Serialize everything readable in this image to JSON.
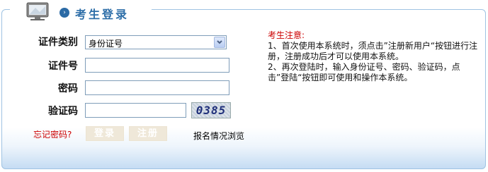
{
  "header": {
    "title": "考生登录"
  },
  "form": {
    "id_type_label": "证件类别",
    "id_type_value": "身份证号",
    "id_number_label": "证件号",
    "id_number_value": "",
    "password_label": "密码",
    "password_value": "",
    "captcha_label": "验证码",
    "captcha_value": "",
    "captcha_image_text": "0385",
    "forgot_password": "忘记密码?",
    "login_button": "登录",
    "register_button": "注册",
    "status_link": "报名情况浏览"
  },
  "notice": {
    "title": "考生注意:",
    "item1": "1、首次使用本系统时，须点击”注册新用户“按钮进行注册，注册成功后才可以使用本系统。",
    "item2": "2、再次登陆时，输入身份证号、密码、验证码，点击”登陆“按钮即可使用和操作本系统。"
  },
  "colors": {
    "accent": "#2d6ea8",
    "border": "#9fc3e3",
    "warning": "#cc0000",
    "button_bg": "#efe8d9"
  },
  "icons": {
    "monitor": "computer-monitor-icon",
    "bullet": "chevron-right-circle-icon",
    "dropdown": "chevron-down-icon"
  }
}
